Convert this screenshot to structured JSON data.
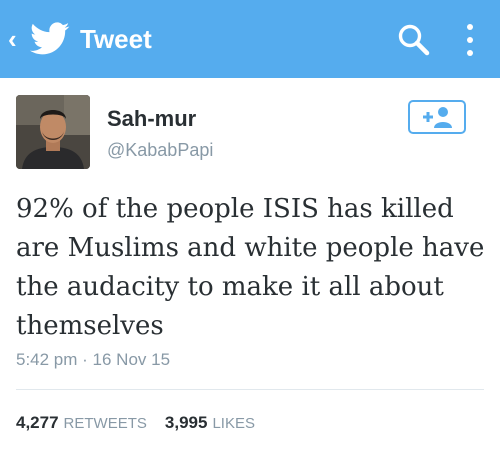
{
  "appbar": {
    "title": "Tweet",
    "color": "#55acee",
    "back_icon": "chevron-left-icon",
    "logo_icon": "twitter-bird-icon",
    "search_icon": "search-icon",
    "menu_icon": "more-vertical-icon"
  },
  "tweet": {
    "author": {
      "display_name": "Sah-mur",
      "handle": "@KababPapi"
    },
    "follow_icon": "follow-user-icon",
    "text": "92% of the people ISIS has killed are Muslims and white people have the audacity to make it all about themselves",
    "timestamp": "5:42 pm · 16 Nov 15",
    "retweets": {
      "count": "4,277",
      "label": "RETWEETS"
    },
    "likes": {
      "count": "3,995",
      "label": "LIKES"
    }
  }
}
